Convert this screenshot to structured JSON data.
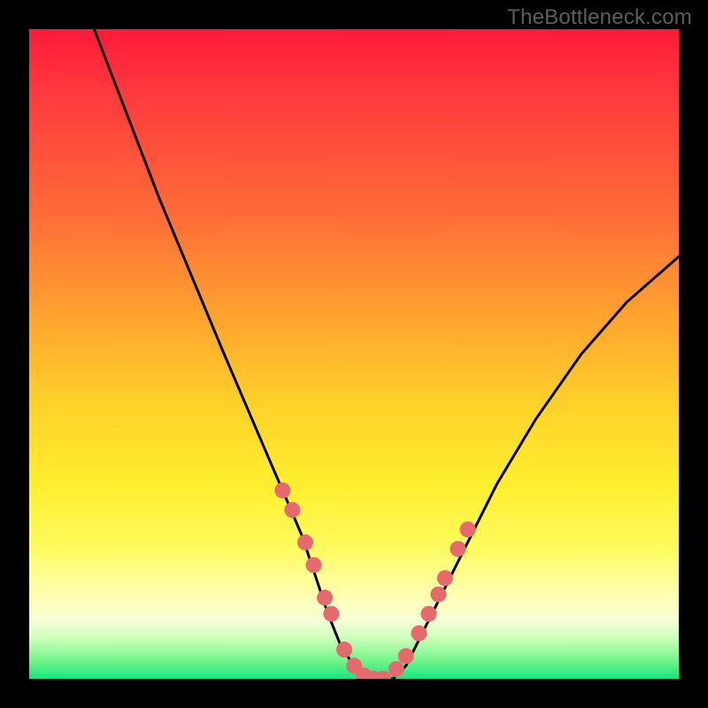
{
  "watermark": "TheBottleneck.com",
  "chart_data": {
    "type": "line",
    "title": "",
    "xlabel": "",
    "ylabel": "",
    "xlim": [
      0,
      100
    ],
    "ylim": [
      0,
      100
    ],
    "grid": false,
    "legend": false,
    "series": [
      {
        "name": "bottleneck-curve",
        "color": "#000000",
        "x": [
          10,
          15,
          20,
          25,
          30,
          33,
          36,
          39,
          42,
          44,
          46,
          48,
          50,
          52,
          54,
          56,
          58,
          60,
          63,
          67,
          72,
          78,
          85,
          92,
          100
        ],
        "y": [
          100,
          87,
          74,
          62,
          50,
          43,
          36,
          29,
          22,
          16,
          10,
          5,
          2,
          0,
          0,
          0,
          2,
          6,
          12,
          20,
          30,
          40,
          50,
          58,
          65
        ]
      }
    ],
    "markers": [
      {
        "name": "left-branch-dots",
        "color": "#e46a6e",
        "x": [
          39.0,
          40.5,
          42.5,
          43.8,
          45.5,
          46.5,
          48.5,
          50.0,
          51.5
        ],
        "y": [
          29.0,
          26.0,
          21.0,
          17.5,
          12.5,
          10.0,
          4.5,
          2.0,
          0.5
        ]
      },
      {
        "name": "right-branch-dots",
        "color": "#e46a6e",
        "x": [
          56.5,
          58.0,
          60.0,
          61.5,
          63.0,
          64.0,
          66.0,
          67.5
        ],
        "y": [
          1.5,
          3.5,
          7.0,
          10.0,
          13.0,
          15.5,
          20.0,
          23.0
        ]
      },
      {
        "name": "valley-bottom-dots",
        "color": "#e46a6e",
        "x": [
          53.0,
          54.5
        ],
        "y": [
          0.0,
          0.0
        ]
      }
    ],
    "gradient_stops": [
      {
        "pos": 0,
        "color": "#ff1a3a"
      },
      {
        "pos": 10,
        "color": "#ff3a3e"
      },
      {
        "pos": 28,
        "color": "#ff6a38"
      },
      {
        "pos": 45,
        "color": "#ffa62e"
      },
      {
        "pos": 58,
        "color": "#ffd22a"
      },
      {
        "pos": 70,
        "color": "#ffee2e"
      },
      {
        "pos": 80,
        "color": "#fffb60"
      },
      {
        "pos": 87,
        "color": "#ffffb0"
      },
      {
        "pos": 91,
        "color": "#f7ffd6"
      },
      {
        "pos": 94,
        "color": "#c8ffb8"
      },
      {
        "pos": 97,
        "color": "#7af58a"
      },
      {
        "pos": 100,
        "color": "#17e680"
      }
    ]
  }
}
